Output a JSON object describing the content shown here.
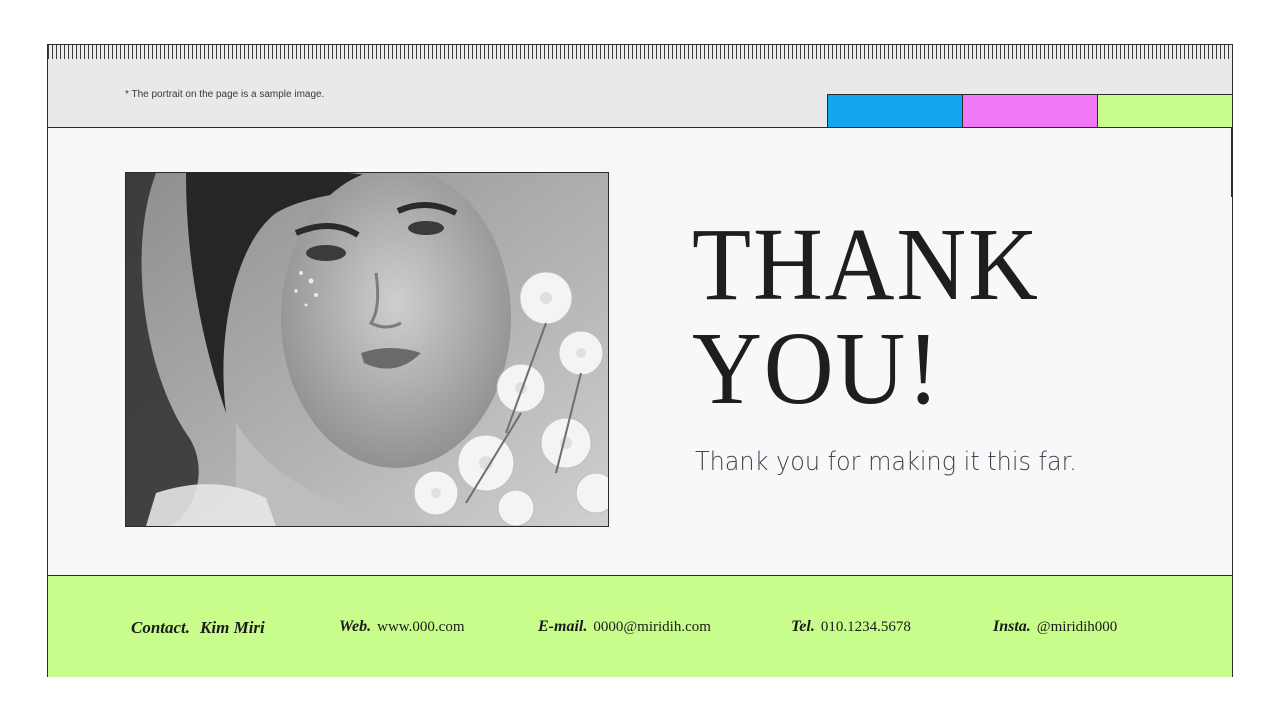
{
  "header": {
    "note": "* The portrait on the page is a sample image.",
    "swatches": [
      {
        "name": "blue",
        "color": "#15a6ee"
      },
      {
        "name": "pink",
        "color": "#ee78f6"
      },
      {
        "name": "lime",
        "color": "#c8fd8b"
      }
    ]
  },
  "main": {
    "photo_alt": "portrait",
    "title_line1": "THANK",
    "title_line2": "YOU!",
    "subtitle": "Thank you for making it this far."
  },
  "footer": {
    "contact": {
      "label": "Contact.",
      "value": "Kim Miri"
    },
    "web": {
      "label": "Web.",
      "value": "www.000.com"
    },
    "email": {
      "label": "E-mail.",
      "value": "0000@miridih.com"
    },
    "tel": {
      "label": "Tel.",
      "value": "010.1234.5678"
    },
    "insta": {
      "label": "Insta.",
      "value": "@miridih000"
    }
  },
  "colors": {
    "accent_lime": "#c8fd8b",
    "accent_blue": "#15a6ee",
    "accent_pink": "#ee78f6",
    "border": "#2b2b2b"
  }
}
